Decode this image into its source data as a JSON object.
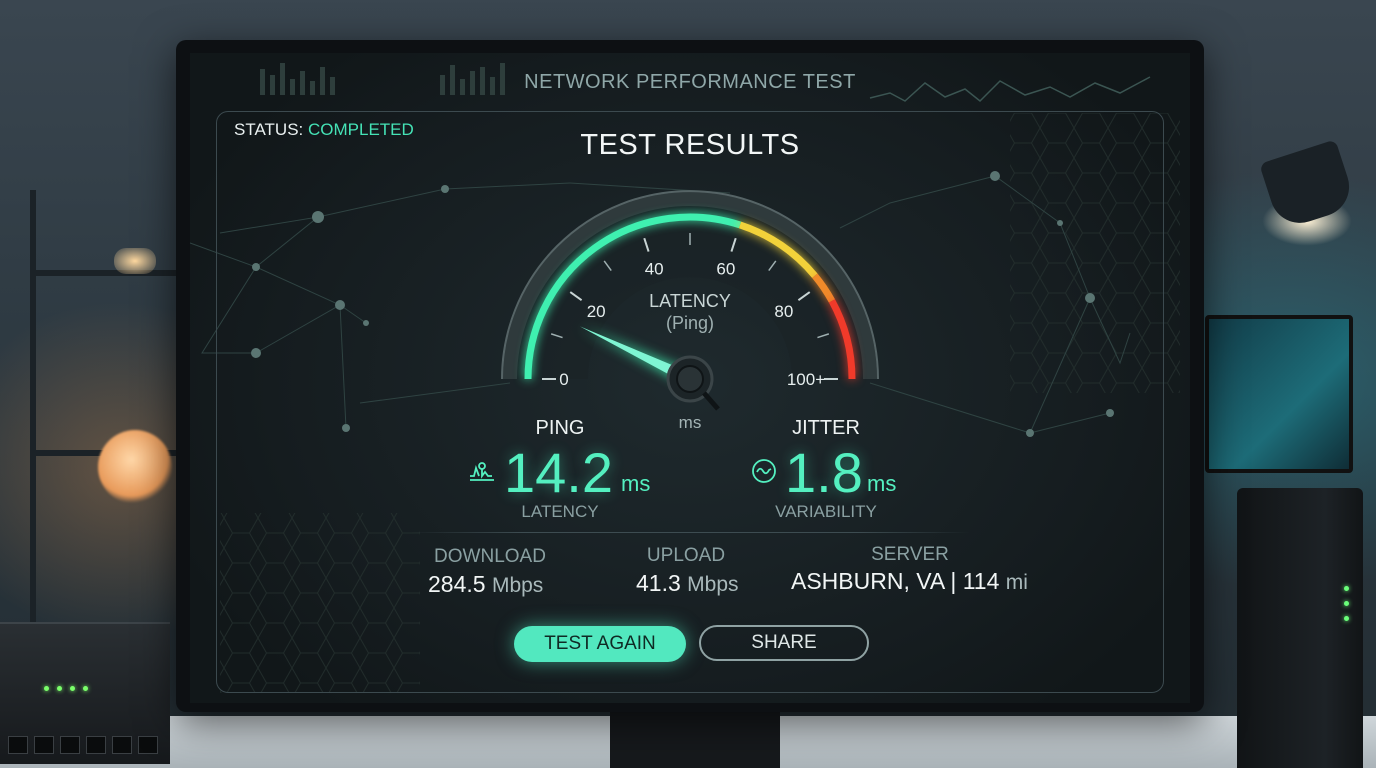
{
  "app": {
    "title": "NETWORK PERFORMANCE TEST",
    "status_label": "STATUS:",
    "status_value": "COMPLETED",
    "results_title": "TEST RESULTS"
  },
  "gauge": {
    "title_line1": "LATENCY",
    "title_line2": "(Ping)",
    "unit": "ms",
    "ticks": [
      "0",
      "20",
      "40",
      "60",
      "80",
      "100+"
    ],
    "min": 0,
    "max": 100,
    "needle_value": 14.2,
    "colors": {
      "green": "#3ff0b0",
      "yellow": "#f2d23a",
      "orange": "#f08a2a",
      "red": "#f03a2a"
    }
  },
  "ping": {
    "label": "PING",
    "value": "14.2",
    "unit": "ms",
    "sub": "LATENCY",
    "icon": "ping-waveform-icon"
  },
  "jitter": {
    "label": "JITTER",
    "value": "1.8",
    "unit": "ms",
    "sub": "VARIABILITY",
    "icon": "wave-circle-icon"
  },
  "stats": {
    "download": {
      "label": "DOWNLOAD",
      "value": "284.5",
      "unit": "Mbps"
    },
    "upload": {
      "label": "UPLOAD",
      "value": "41.3",
      "unit": "Mbps"
    },
    "server": {
      "label": "SERVER",
      "value": "ASHBURN, VA | 114",
      "unit": "mi"
    }
  },
  "buttons": {
    "test_again": "TEST AGAIN",
    "share": "SHARE"
  },
  "theme": {
    "accent": "#52e8bf",
    "text": "#f2f6f6",
    "muted": "#8aa0a2"
  }
}
